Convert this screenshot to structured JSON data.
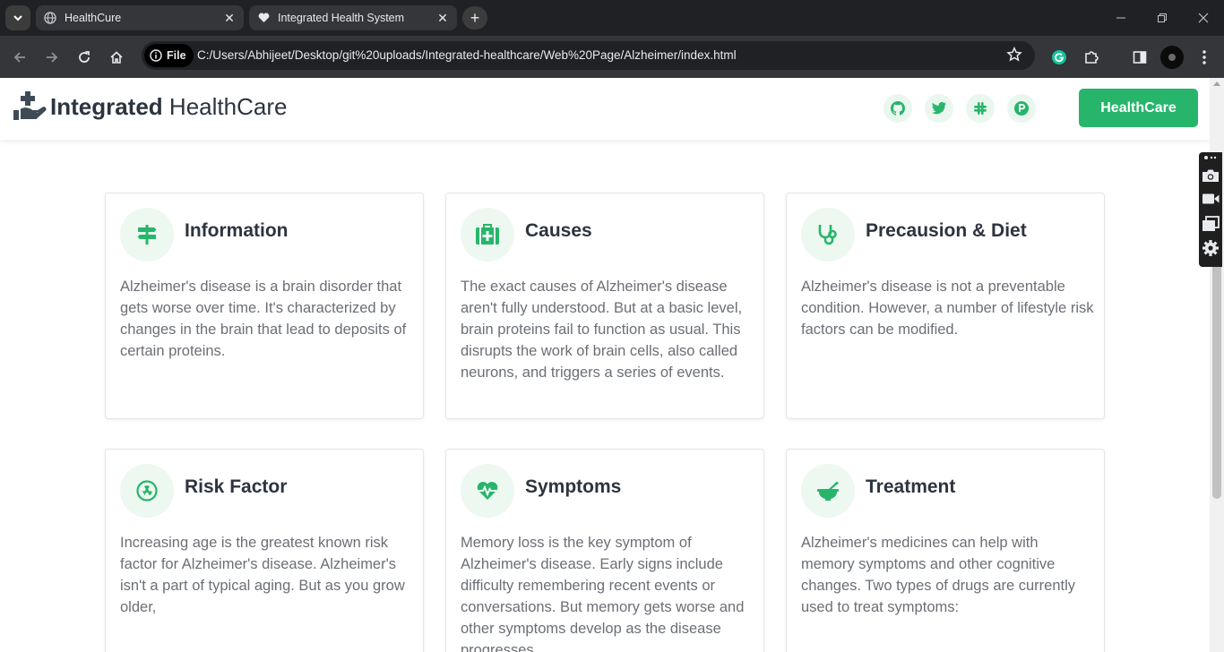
{
  "browser": {
    "tabs": [
      {
        "title": "HealthCure",
        "active": false
      },
      {
        "title": "Integrated Health System",
        "active": true
      }
    ],
    "file_chip": "File",
    "url": "C:/Users/Abhijeet/Desktop/git%20uploads/Integrated-healthcare/Web%20Page/Alzheimer/index.html"
  },
  "header": {
    "brand_strong": "Integrated",
    "brand_light": "HealthCare",
    "social_icons": [
      "github-icon",
      "twitter-icon",
      "slack-icon",
      "product-hunt-icon"
    ],
    "cta_label": "HealthCare"
  },
  "colors": {
    "accent": "#27b56b",
    "accent_light": "#edf8f1",
    "heading": "#2c3440",
    "body_text": "#6b6f76"
  },
  "cards": [
    {
      "icon": "signpost-icon",
      "title": "Information",
      "text": "Alzheimer's disease is a brain disorder that gets worse over time. It's characterized by changes in the brain that lead to deposits of certain proteins."
    },
    {
      "icon": "first-aid-kit-icon",
      "title": "Causes",
      "text": "The exact causes of Alzheimer's disease aren't fully understood. But at a basic level, brain proteins fail to function as usual. This disrupts the work of brain cells, also called neurons, and triggers a series of events."
    },
    {
      "icon": "stethoscope-icon",
      "title": "Precausion & Diet",
      "text": "Alzheimer's disease is not a preventable condition. However, a number of lifestyle risk factors can be modified."
    },
    {
      "icon": "radiation-icon",
      "title": "Risk Factor",
      "text": "Increasing age is the greatest known risk factor for Alzheimer's disease. Alzheimer's isn't a part of typical aging. But as you grow older,"
    },
    {
      "icon": "heartbeat-icon",
      "title": "Symptoms",
      "text": "Memory loss is the key symptom of Alzheimer's disease. Early signs include difficulty remembering recent events or conversations. But memory gets worse and other symptoms develop as the disease progresses."
    },
    {
      "icon": "mortar-pestle-icon",
      "title": "Treatment",
      "text": "Alzheimer's medicines can help with memory symptoms and other cognitive changes. Two types of drugs are currently used to treat symptoms:"
    }
  ]
}
